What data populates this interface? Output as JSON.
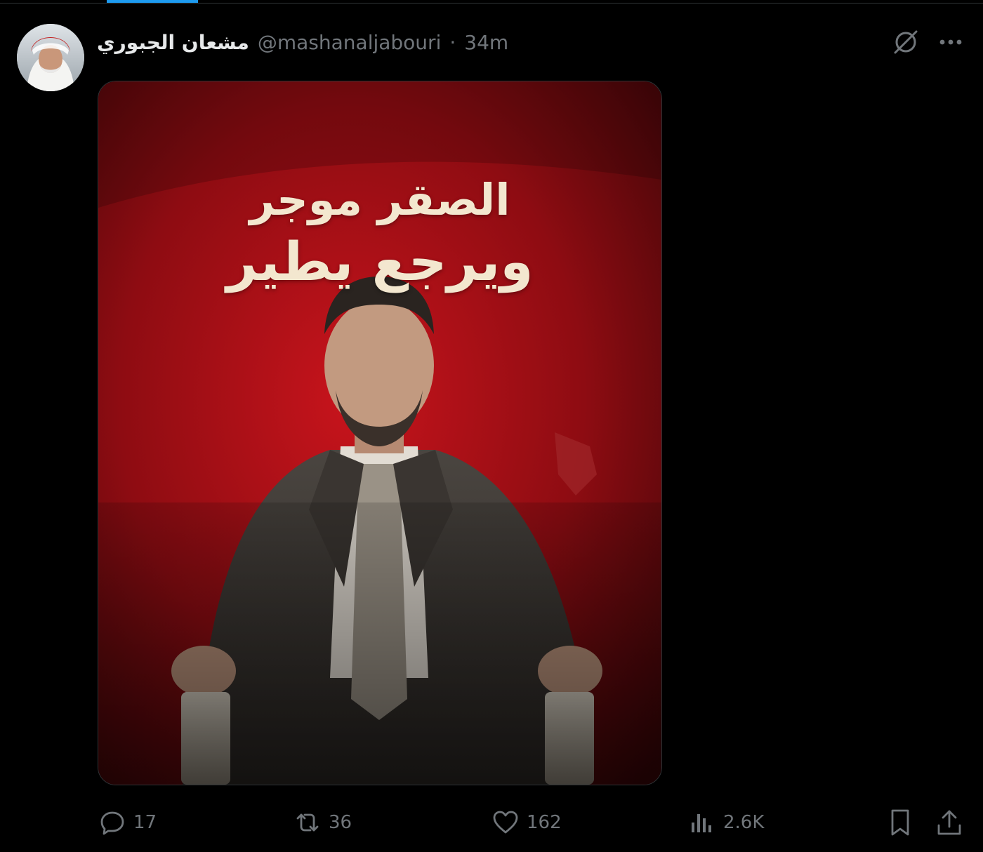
{
  "tweet": {
    "display_name": "مشعان الجبوري",
    "handle": "@mashanaljabouri",
    "separator": "·",
    "time": "34m"
  },
  "poster": {
    "line1": "الصقر موجر",
    "line2": "ويرجع يطير"
  },
  "actions": {
    "replies": "17",
    "reposts": "36",
    "likes": "162",
    "views": "2.6K"
  },
  "icons": [
    "grok-icon",
    "more-icon",
    "reply-icon",
    "repost-icon",
    "like-icon",
    "views-icon",
    "bookmark-icon",
    "share-icon"
  ],
  "colors": {
    "background": "#000000",
    "muted": "#71767b",
    "text": "#e7e9ea",
    "accent": "#1d9bf0",
    "poster_red": "#b3141b"
  }
}
